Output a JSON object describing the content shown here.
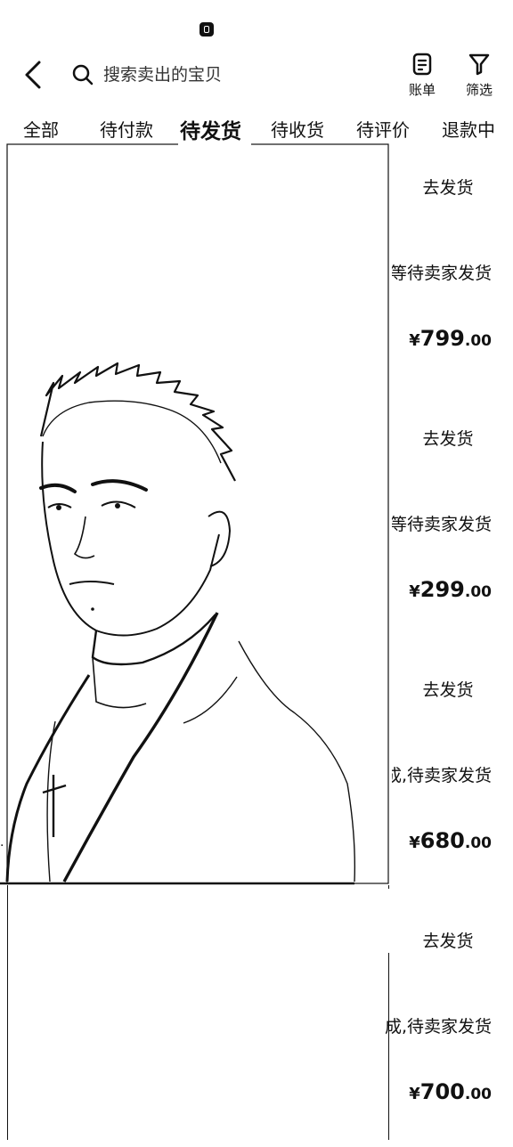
{
  "search": {
    "placeholder": "搜索卖出的宝贝"
  },
  "header": {
    "actions": [
      {
        "label": "账单",
        "icon": "bill-icon"
      },
      {
        "label": "筛选",
        "icon": "filter-icon"
      }
    ]
  },
  "tabs": [
    {
      "label": "全部",
      "active": false
    },
    {
      "label": "待付款",
      "active": false
    },
    {
      "label": "待发货",
      "active": true
    },
    {
      "label": "待收货",
      "active": false
    },
    {
      "label": "待评价",
      "active": false
    },
    {
      "label": "退款中",
      "active": false
    }
  ],
  "orders": [
    {
      "action": "去发货",
      "status": "等待卖家发货",
      "price_symbol": "¥",
      "price_int": "799",
      "price_dec": ".00"
    },
    {
      "action": "去发货",
      "status": "等待卖家发货",
      "price_symbol": "¥",
      "price_int": "299",
      "price_dec": ".00"
    },
    {
      "action": "去发货",
      "status": "成,待卖家发货",
      "price_symbol": "¥",
      "price_int": "680",
      "price_dec": ".00"
    },
    {
      "action": "去发货",
      "status": "成,待卖家发货",
      "price_symbol": "¥",
      "price_int": "700",
      "price_dec": ".00"
    }
  ],
  "colors": {
    "ink": "#111111",
    "background": "#ffffff"
  }
}
